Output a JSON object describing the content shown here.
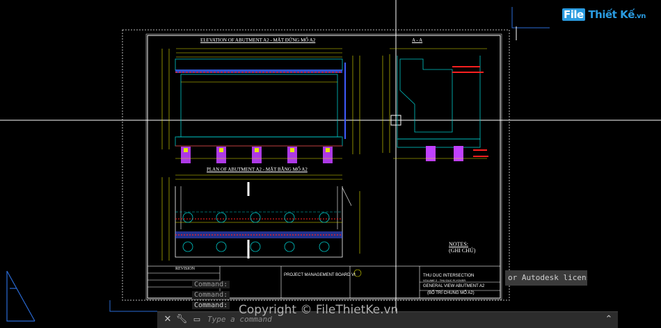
{
  "app": {
    "logo_file": "File",
    "logo_thiet": "Thiết",
    "logo_ke": "Kế",
    "logo_domain": ".vn"
  },
  "drawing": {
    "title_elevation": "ELEVATION OF ABUTMENT A2 - MẶT ĐỨNG MỐ A2",
    "title_section": "A - A",
    "title_plan": "PLAN OF ABUTMENT A2 - MẶT BẰNG MỐ A2",
    "revision_label": "REVISION",
    "notes_title": "NOTES:",
    "notes_sub": "(GHI CHÚ)",
    "project_board": "PROJECT MANAGEMENT BOARD VI",
    "project_name": "THU DUC INTERSECTION",
    "sheet_title": "GENERAL VIEW ABUTMENT A2",
    "sheet_subtitle": "(BỐ TRÍ CHUNG MỐ A2)",
    "volume": "VOLUME 2 - THU DUC FLYOVER"
  },
  "command": {
    "history_1": "Command:",
    "history_2": "Command:",
    "history_3": "Command:",
    "placeholder": "Type a command",
    "license_text": "or Autodesk licensed"
  },
  "watermark": "Copyright © FileThietKe.vn",
  "colors": {
    "background": "#000000",
    "sheet_border": "#ffffff",
    "crosshair": "#ffffff",
    "dim_yellow": "#e6e600",
    "concrete_cyan": "#00c8c8",
    "rebar_red": "#ff2020",
    "pile_magenta": "#c040ff",
    "viewcube_blue": "#2a6bd6"
  },
  "icons": [
    "close-icon",
    "wrench-icon",
    "command-prompt-icon",
    "chevron-up-icon",
    "ucs-icon"
  ]
}
